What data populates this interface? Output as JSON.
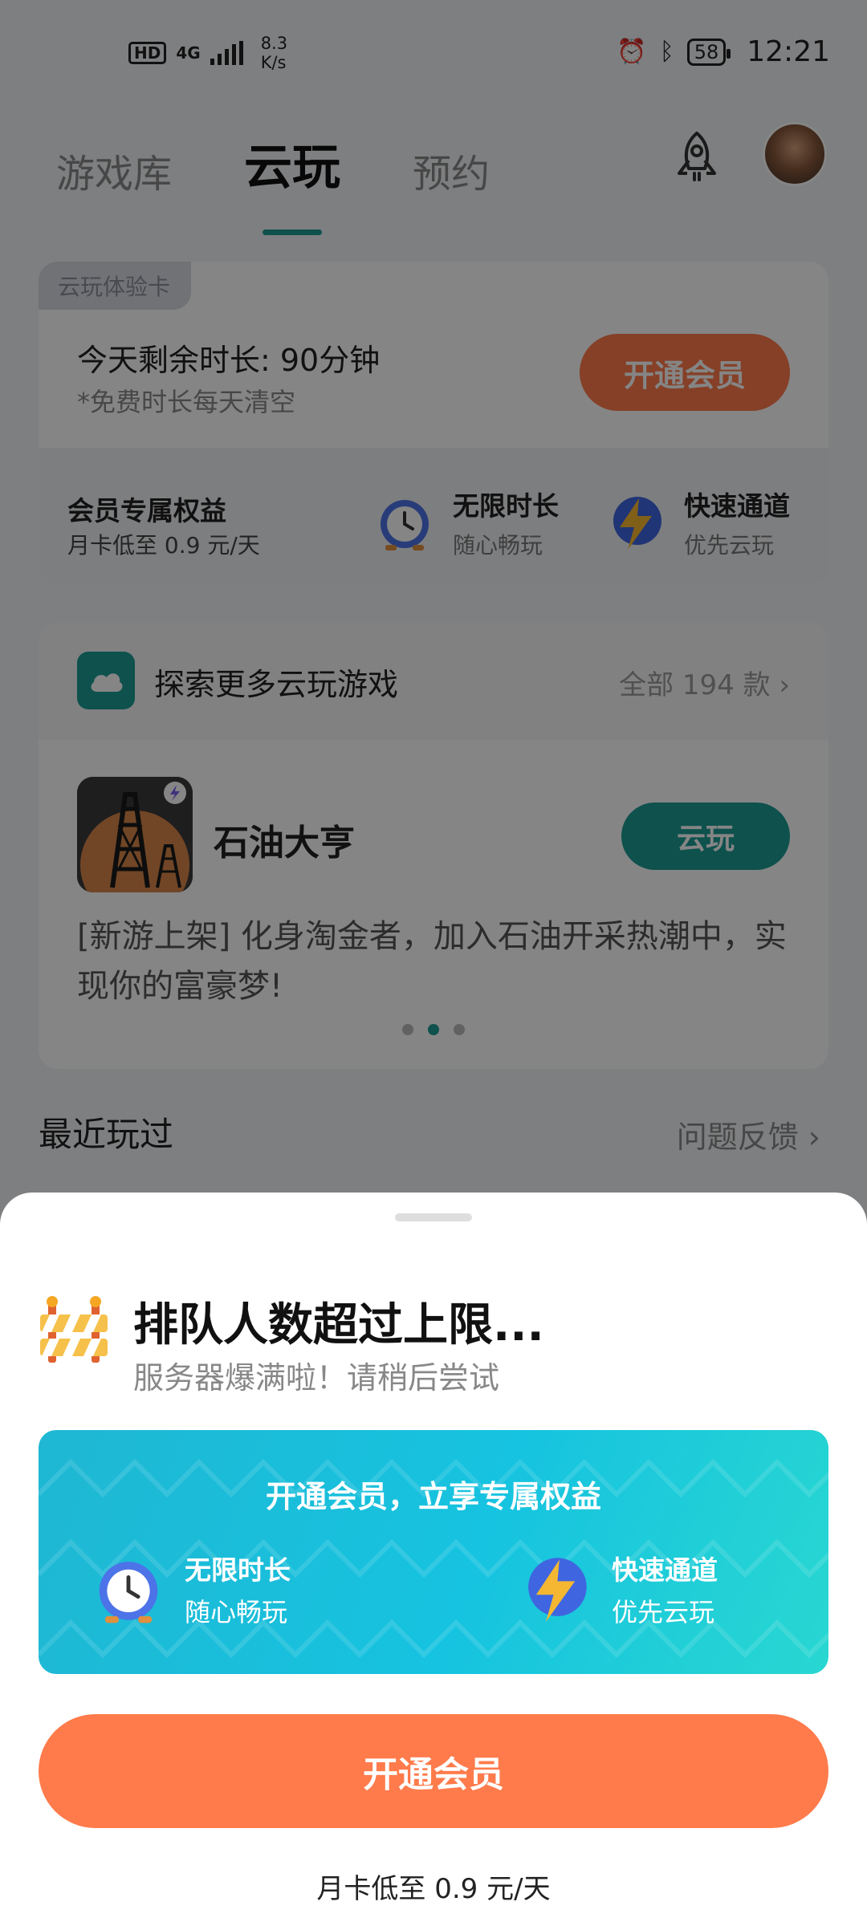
{
  "status_bar": {
    "hd": "HD",
    "network": "4G",
    "speed_value": "8.3",
    "speed_unit": "K/s",
    "battery": "58",
    "time": "12:21"
  },
  "tabs": [
    {
      "label": "游戏库",
      "active": false
    },
    {
      "label": "云玩",
      "active": true
    },
    {
      "label": "预约",
      "active": false
    }
  ],
  "trial_card": {
    "tag": "云玩体验卡",
    "remaining": "今天剩余时长: 90分钟",
    "note": "*免费时长每天清空",
    "open_button": "开通会员",
    "perks_title": "会员专属权益",
    "perks_price": "月卡低至 0.9 元/天",
    "perks": [
      {
        "icon": "clock-icon",
        "name": "无限时长",
        "desc": "随心畅玩"
      },
      {
        "icon": "lightning-icon",
        "name": "快速通道",
        "desc": "优先云玩"
      }
    ]
  },
  "explore_card": {
    "title": "探索更多云玩游戏",
    "count": "全部 194 款 ›",
    "game_name": "石油大亨",
    "play_button": "云玩",
    "description": "[新游上架] 化身淘金者，加入石油开采热潮中，实现你的富豪梦!",
    "carousel_pages": 3,
    "carousel_active_index": 1
  },
  "recent": {
    "title": "最近玩过",
    "feedback": "问题反馈 ›"
  },
  "sheet": {
    "title": "排队人数超过上限...",
    "subtitle": "服务器爆满啦！请稍后尝试",
    "banner_title": "开通会员，立享专属权益",
    "perks": [
      {
        "icon": "clock-icon",
        "name": "无限时长",
        "desc": "随心畅玩"
      },
      {
        "icon": "lightning-icon",
        "name": "快速通道",
        "desc": "优先云玩"
      }
    ],
    "open_button": "开通会员",
    "price_note": "月卡低至 0.9 元/天"
  },
  "colors": {
    "accent": "#1b9b95",
    "orange": "#ff7b4b",
    "banner": "#16c3e0"
  }
}
